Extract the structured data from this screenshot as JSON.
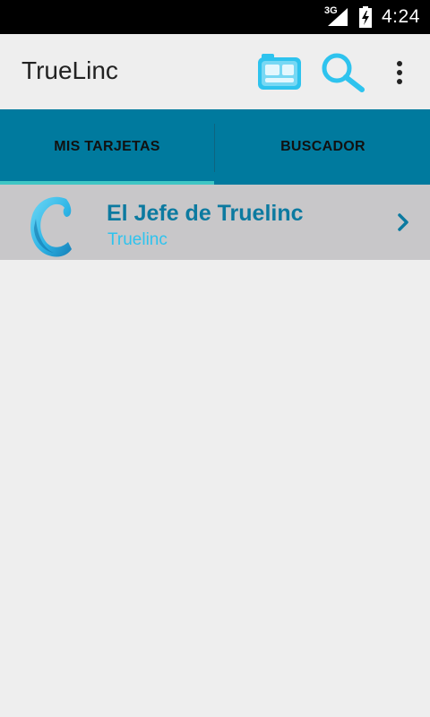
{
  "status_bar": {
    "network_type": "3G",
    "time": "4:24",
    "icons": [
      "signal-icon",
      "battery-charging-icon"
    ]
  },
  "action_bar": {
    "title": "TrueLinc",
    "actions": [
      {
        "icon": "camera-icon"
      },
      {
        "icon": "search-icon"
      },
      {
        "icon": "overflow-menu-icon"
      }
    ],
    "accent_color": "#2ec3ee"
  },
  "tabs": [
    {
      "label": "MIS TARJETAS",
      "selected": true
    },
    {
      "label": "BUSCADOR",
      "selected": false
    }
  ],
  "tab_colors": {
    "background": "#007a9e",
    "indicator": "#3ec6c4"
  },
  "cards": [
    {
      "name": "El Jefe de Truelinc",
      "company": "Truelinc",
      "logo_icon": "truelinc-logo-icon",
      "chevron_icon": "chevron-right-icon"
    }
  ]
}
